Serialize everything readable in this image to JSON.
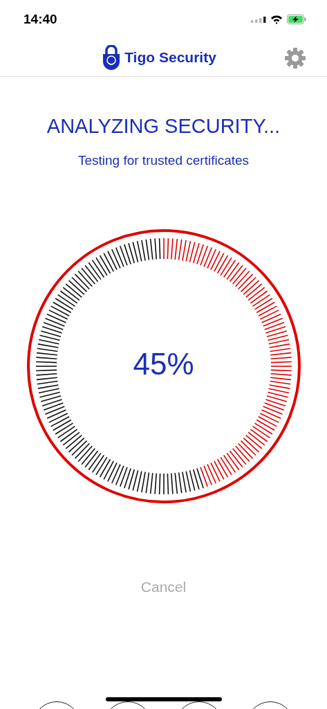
{
  "status_bar": {
    "time": "14:40"
  },
  "header": {
    "title": "Tigo Security"
  },
  "scan": {
    "title": "ANALYZING SECURITY...",
    "subtitle": "Testing for trusted certificates",
    "level": 0.45,
    "reading": "45%"
  },
  "cancel_button": {
    "label": "Cancel"
  },
  "bottom_tabs": [
    {
      "kind": "circle"
    },
    {
      "kind": "circle"
    },
    {
      "kind": "circle"
    },
    {
      "kind": "circle"
    }
  ]
}
